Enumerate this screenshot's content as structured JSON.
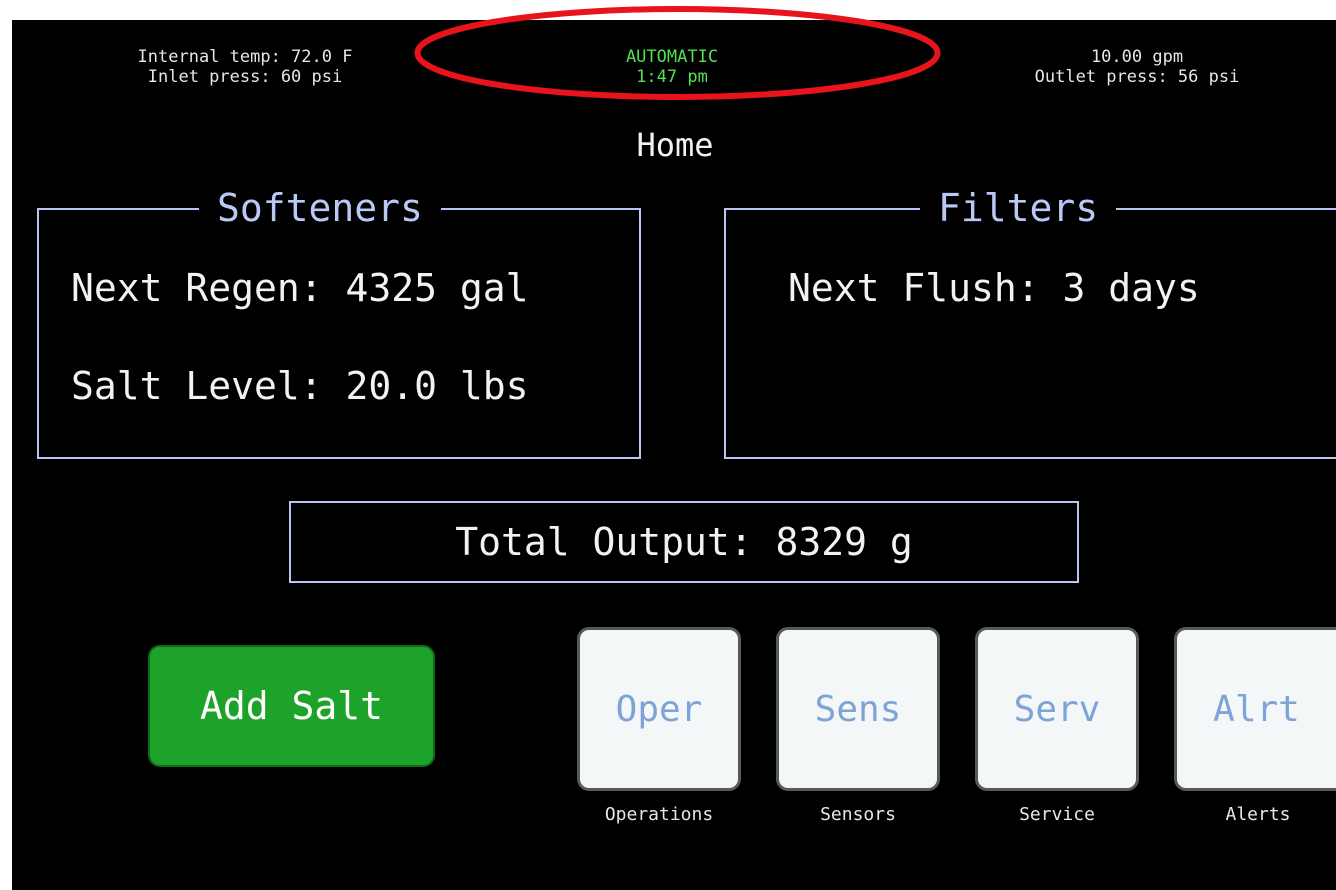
{
  "status_bar": {
    "internal_temp": "Internal temp: 72.0 F",
    "inlet_press": "Inlet press: 60 psi",
    "mode": "AUTOMATIC",
    "time": "1:47 pm",
    "flow_rate": "10.00 gpm",
    "outlet_press": "Outlet press: 56 psi"
  },
  "page_title": "Home",
  "softeners": {
    "title": "Softeners",
    "next_regen": "Next Regen: 4325 gal",
    "salt_level": "Salt Level: 20.0 lbs"
  },
  "filters": {
    "title": "Filters",
    "next_flush": "Next Flush: 3 days"
  },
  "total_output": "Total Output: 8329 g",
  "add_salt_label": "Add Salt",
  "nav_buttons": [
    {
      "label": "Oper",
      "caption": "Operations"
    },
    {
      "label": "Sens",
      "caption": "Sensors"
    },
    {
      "label": "Serv",
      "caption": "Service"
    },
    {
      "label": "Alrt",
      "caption": "Alerts"
    }
  ],
  "colors": {
    "background": "#000000",
    "status_green": "#52e052",
    "panel_border": "#b8c6f0",
    "add_salt_green": "#1ea32a",
    "nav_label_blue": "#7ea3d6",
    "annotation_red": "#e8141b"
  }
}
